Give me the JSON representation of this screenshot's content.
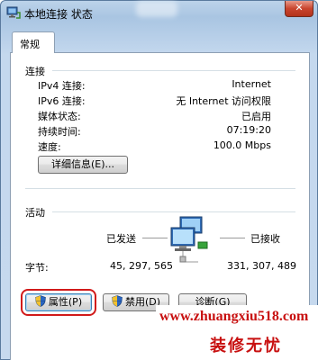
{
  "window": {
    "title": "本地连接 状态",
    "close_glyph": "✕"
  },
  "tabs": [
    {
      "label": "常规",
      "selected": true
    }
  ],
  "connection": {
    "heading": "连接",
    "rows": [
      {
        "label": "IPv4 连接:",
        "value": "Internet"
      },
      {
        "label": "IPv6 连接:",
        "value": "无 Internet 访问权限"
      },
      {
        "label": "媒体状态:",
        "value": "已启用"
      },
      {
        "label": "持续时间:",
        "value": "07:19:20"
      },
      {
        "label": "速度:",
        "value": "100.0 Mbps"
      }
    ],
    "details_button": "详细信息(E)..."
  },
  "activity": {
    "heading": "活动",
    "sent_label": "已发送",
    "received_label": "已接收",
    "bytes_label": "字节:",
    "bytes_sent": "45, 297, 565",
    "bytes_received": "331, 307, 489"
  },
  "buttons": {
    "properties": "属性(P)",
    "disable": "禁用(D)",
    "diagnose": "诊断(G)"
  },
  "watermark": {
    "url": "www.zhuangxiu518.com",
    "text": "装修无忧"
  },
  "icons": {
    "window_icon": "network-connection-icon",
    "activity_icon": "network-computers-icon",
    "uac": "uac-shield-icon"
  }
}
